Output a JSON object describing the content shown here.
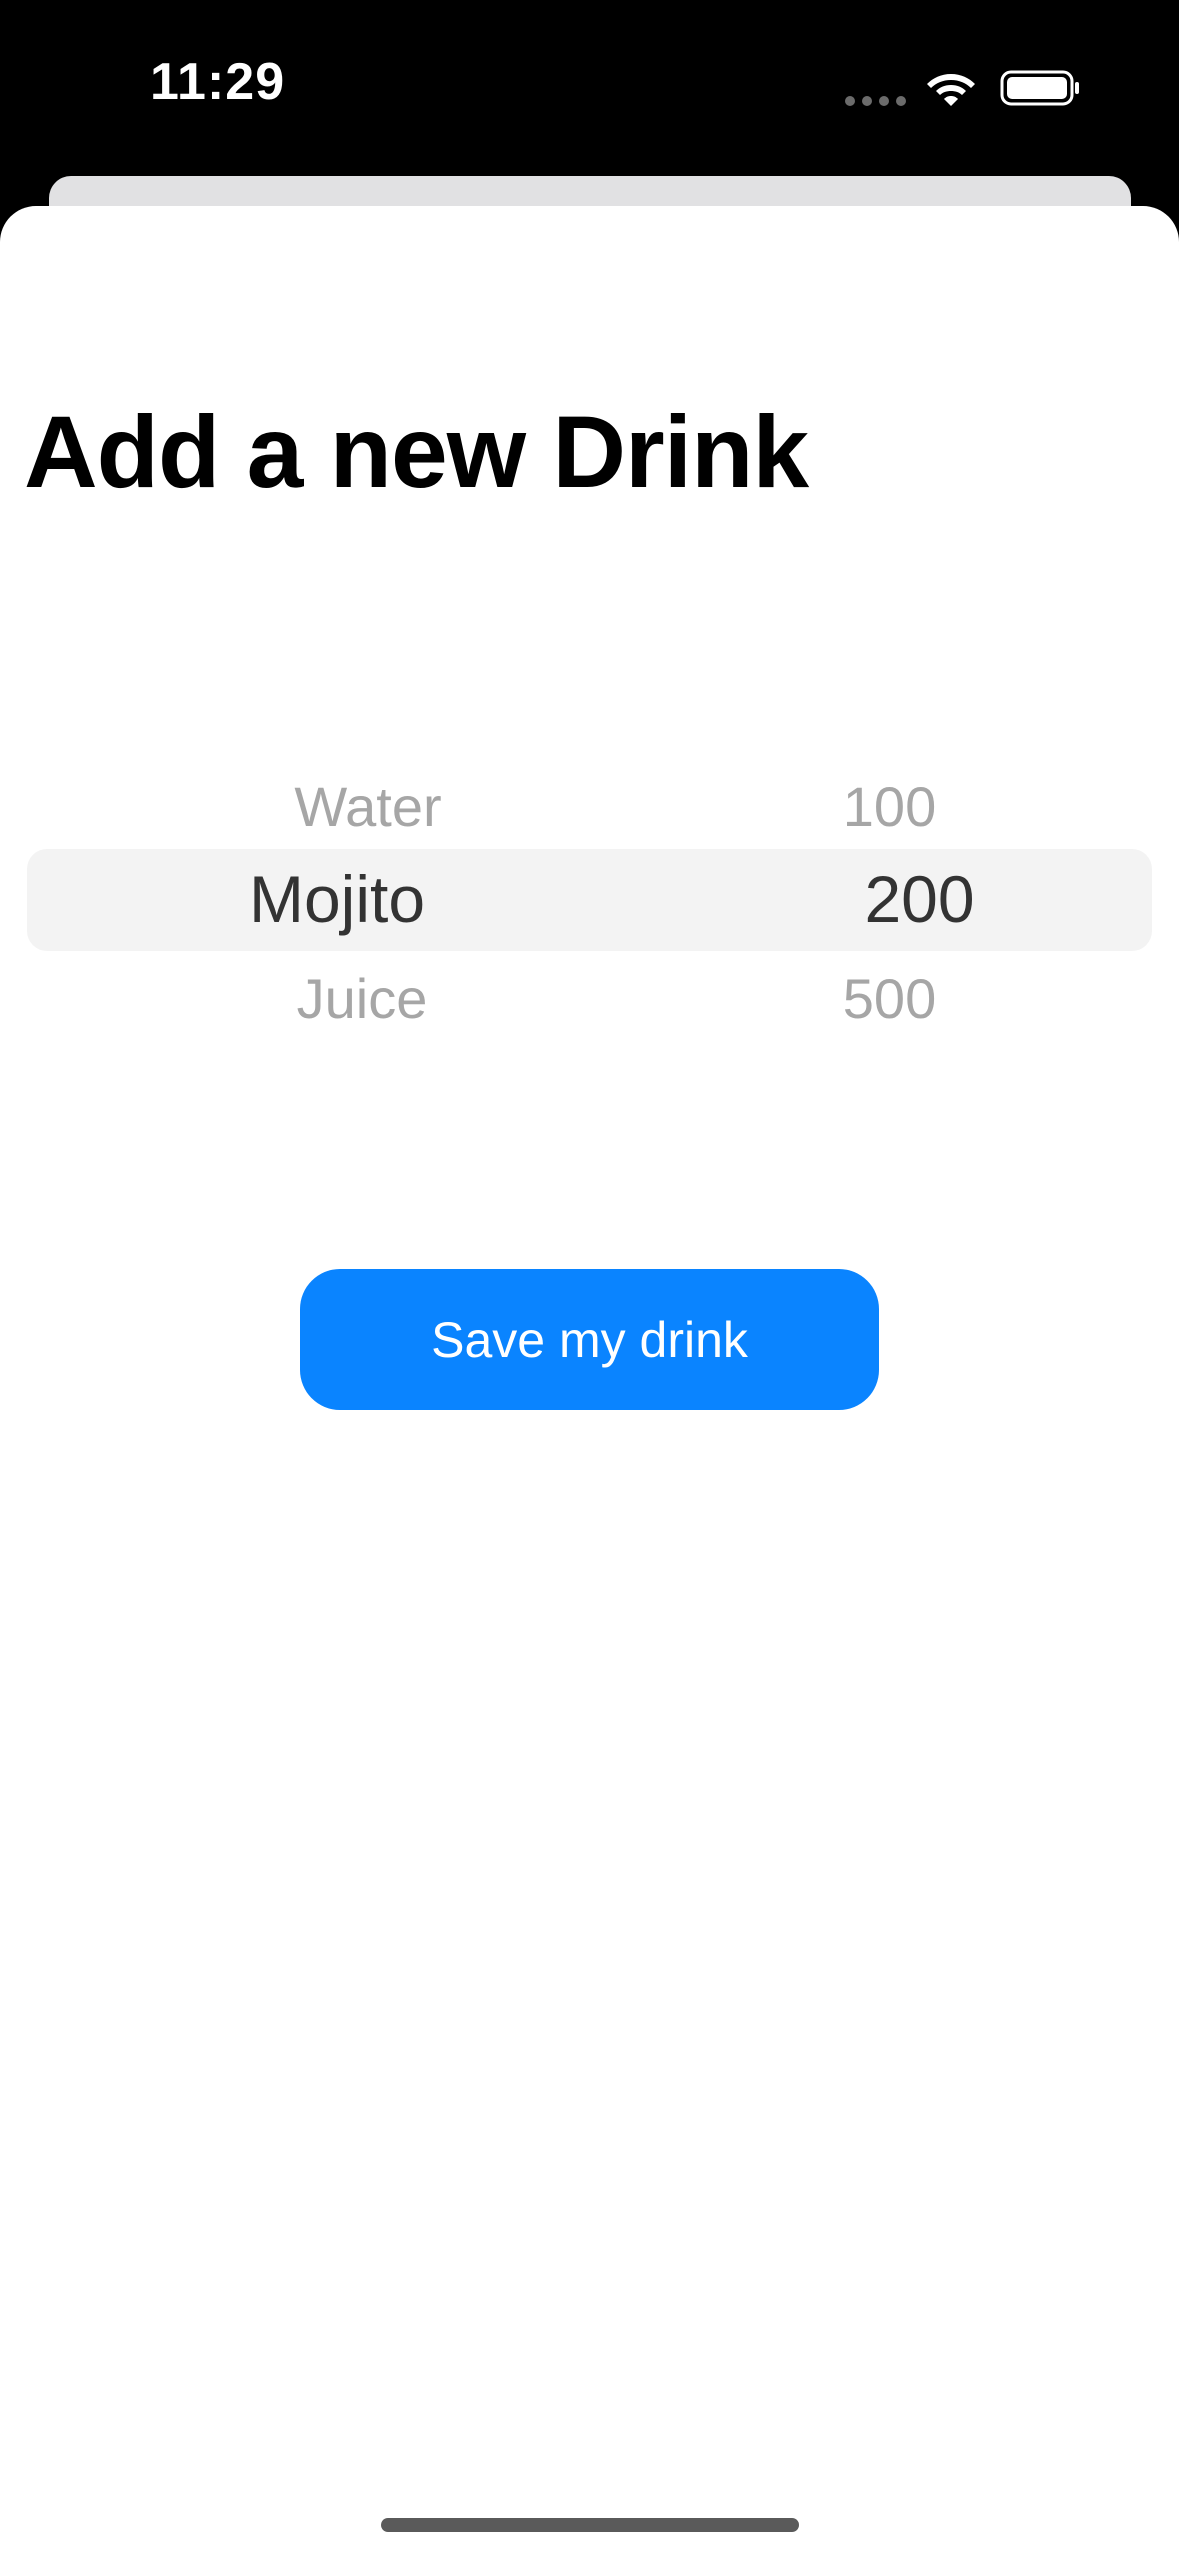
{
  "status_bar": {
    "time": "11:29",
    "signal_icon": "cellular-dots-icon",
    "wifi_icon": "wifi-icon",
    "battery_icon": "battery-icon"
  },
  "sheet": {
    "title": "Add a new Drink"
  },
  "picker": {
    "drinks": {
      "above": "Water",
      "selected": "Mojito",
      "below": "Juice"
    },
    "amounts": {
      "above": "100",
      "selected": "200",
      "below": "500"
    }
  },
  "actions": {
    "save_label": "Save my drink"
  },
  "colors": {
    "accent": "#0a84ff",
    "status_bar_bg": "#000000",
    "sheet_bg": "#ffffff",
    "picker_highlight": "#f3f3f3"
  }
}
